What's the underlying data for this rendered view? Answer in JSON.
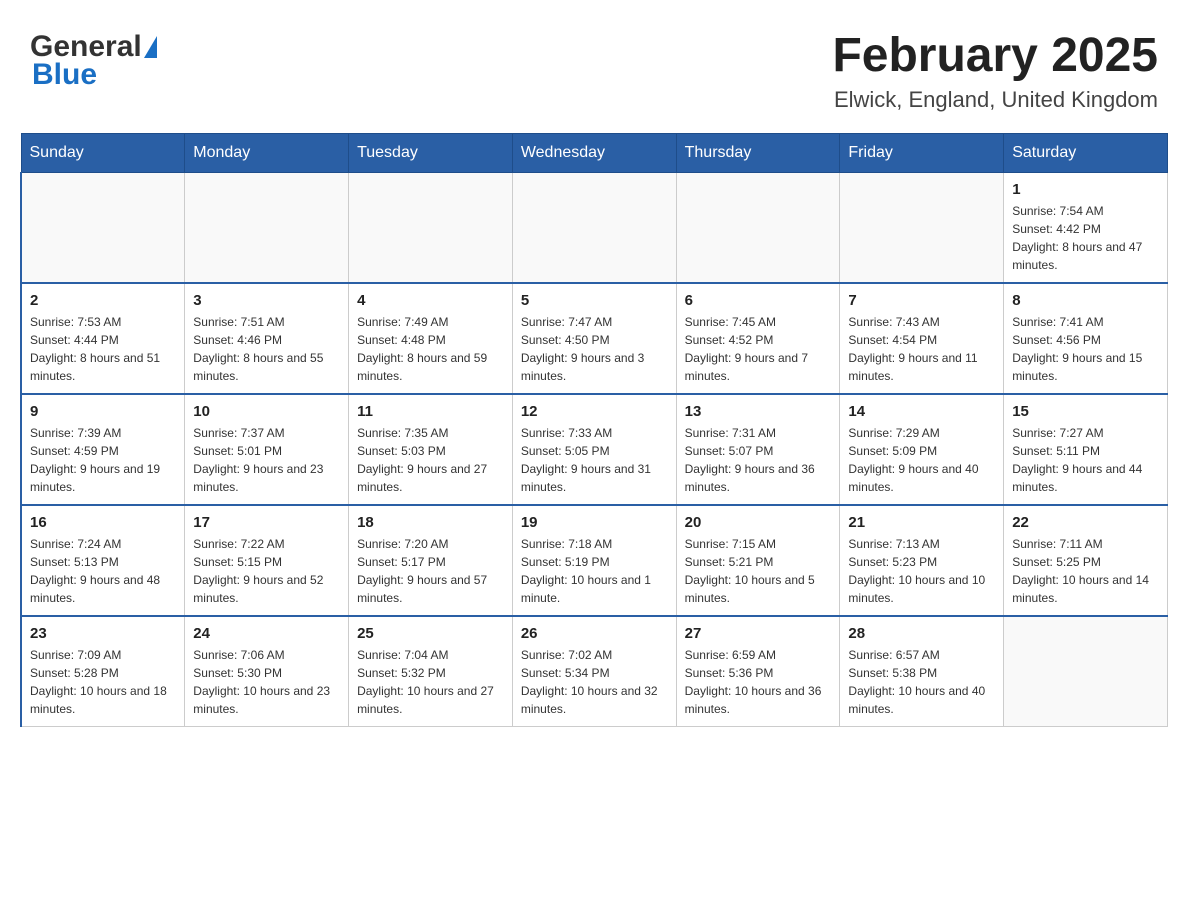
{
  "header": {
    "logo_general": "General",
    "logo_blue": "Blue",
    "title": "February 2025",
    "subtitle": "Elwick, England, United Kingdom"
  },
  "days_of_week": [
    "Sunday",
    "Monday",
    "Tuesday",
    "Wednesday",
    "Thursday",
    "Friday",
    "Saturday"
  ],
  "weeks": [
    {
      "days": [
        {
          "number": "",
          "info": ""
        },
        {
          "number": "",
          "info": ""
        },
        {
          "number": "",
          "info": ""
        },
        {
          "number": "",
          "info": ""
        },
        {
          "number": "",
          "info": ""
        },
        {
          "number": "",
          "info": ""
        },
        {
          "number": "1",
          "info": "Sunrise: 7:54 AM\nSunset: 4:42 PM\nDaylight: 8 hours and 47 minutes."
        }
      ]
    },
    {
      "days": [
        {
          "number": "2",
          "info": "Sunrise: 7:53 AM\nSunset: 4:44 PM\nDaylight: 8 hours and 51 minutes."
        },
        {
          "number": "3",
          "info": "Sunrise: 7:51 AM\nSunset: 4:46 PM\nDaylight: 8 hours and 55 minutes."
        },
        {
          "number": "4",
          "info": "Sunrise: 7:49 AM\nSunset: 4:48 PM\nDaylight: 8 hours and 59 minutes."
        },
        {
          "number": "5",
          "info": "Sunrise: 7:47 AM\nSunset: 4:50 PM\nDaylight: 9 hours and 3 minutes."
        },
        {
          "number": "6",
          "info": "Sunrise: 7:45 AM\nSunset: 4:52 PM\nDaylight: 9 hours and 7 minutes."
        },
        {
          "number": "7",
          "info": "Sunrise: 7:43 AM\nSunset: 4:54 PM\nDaylight: 9 hours and 11 minutes."
        },
        {
          "number": "8",
          "info": "Sunrise: 7:41 AM\nSunset: 4:56 PM\nDaylight: 9 hours and 15 minutes."
        }
      ]
    },
    {
      "days": [
        {
          "number": "9",
          "info": "Sunrise: 7:39 AM\nSunset: 4:59 PM\nDaylight: 9 hours and 19 minutes."
        },
        {
          "number": "10",
          "info": "Sunrise: 7:37 AM\nSunset: 5:01 PM\nDaylight: 9 hours and 23 minutes."
        },
        {
          "number": "11",
          "info": "Sunrise: 7:35 AM\nSunset: 5:03 PM\nDaylight: 9 hours and 27 minutes."
        },
        {
          "number": "12",
          "info": "Sunrise: 7:33 AM\nSunset: 5:05 PM\nDaylight: 9 hours and 31 minutes."
        },
        {
          "number": "13",
          "info": "Sunrise: 7:31 AM\nSunset: 5:07 PM\nDaylight: 9 hours and 36 minutes."
        },
        {
          "number": "14",
          "info": "Sunrise: 7:29 AM\nSunset: 5:09 PM\nDaylight: 9 hours and 40 minutes."
        },
        {
          "number": "15",
          "info": "Sunrise: 7:27 AM\nSunset: 5:11 PM\nDaylight: 9 hours and 44 minutes."
        }
      ]
    },
    {
      "days": [
        {
          "number": "16",
          "info": "Sunrise: 7:24 AM\nSunset: 5:13 PM\nDaylight: 9 hours and 48 minutes."
        },
        {
          "number": "17",
          "info": "Sunrise: 7:22 AM\nSunset: 5:15 PM\nDaylight: 9 hours and 52 minutes."
        },
        {
          "number": "18",
          "info": "Sunrise: 7:20 AM\nSunset: 5:17 PM\nDaylight: 9 hours and 57 minutes."
        },
        {
          "number": "19",
          "info": "Sunrise: 7:18 AM\nSunset: 5:19 PM\nDaylight: 10 hours and 1 minute."
        },
        {
          "number": "20",
          "info": "Sunrise: 7:15 AM\nSunset: 5:21 PM\nDaylight: 10 hours and 5 minutes."
        },
        {
          "number": "21",
          "info": "Sunrise: 7:13 AM\nSunset: 5:23 PM\nDaylight: 10 hours and 10 minutes."
        },
        {
          "number": "22",
          "info": "Sunrise: 7:11 AM\nSunset: 5:25 PM\nDaylight: 10 hours and 14 minutes."
        }
      ]
    },
    {
      "days": [
        {
          "number": "23",
          "info": "Sunrise: 7:09 AM\nSunset: 5:28 PM\nDaylight: 10 hours and 18 minutes."
        },
        {
          "number": "24",
          "info": "Sunrise: 7:06 AM\nSunset: 5:30 PM\nDaylight: 10 hours and 23 minutes."
        },
        {
          "number": "25",
          "info": "Sunrise: 7:04 AM\nSunset: 5:32 PM\nDaylight: 10 hours and 27 minutes."
        },
        {
          "number": "26",
          "info": "Sunrise: 7:02 AM\nSunset: 5:34 PM\nDaylight: 10 hours and 32 minutes."
        },
        {
          "number": "27",
          "info": "Sunrise: 6:59 AM\nSunset: 5:36 PM\nDaylight: 10 hours and 36 minutes."
        },
        {
          "number": "28",
          "info": "Sunrise: 6:57 AM\nSunset: 5:38 PM\nDaylight: 10 hours and 40 minutes."
        },
        {
          "number": "",
          "info": ""
        }
      ]
    }
  ]
}
